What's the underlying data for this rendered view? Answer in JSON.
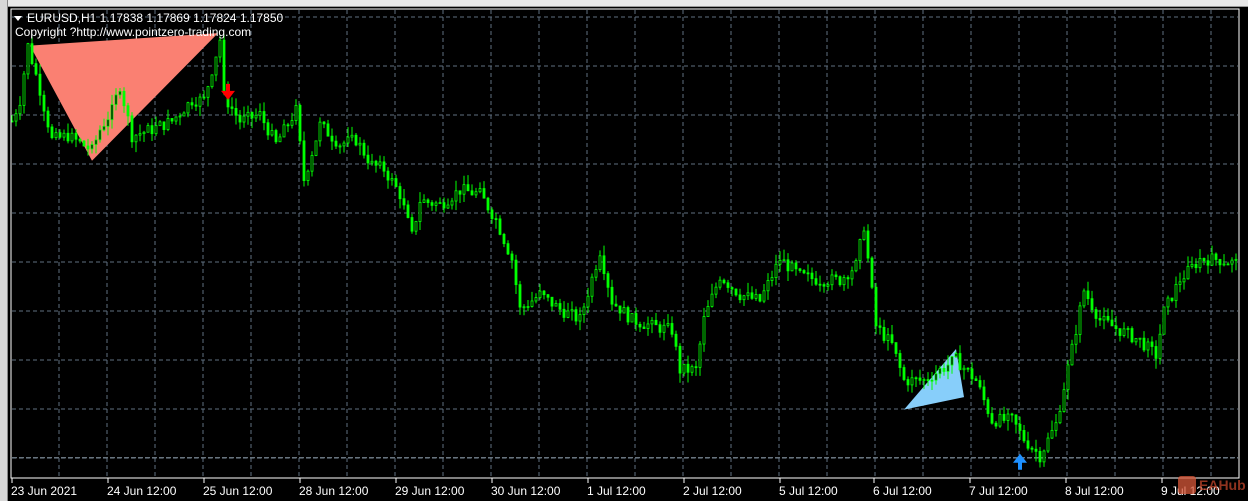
{
  "header": {
    "symbol_line": "EURUSD,H1  1.17838 1.17869 1.17824 1.17850",
    "copyright": "Copyright ?http://www.pointzero-trading.com"
  },
  "watermark": {
    "text": "EAHub"
  },
  "colors": {
    "candle": "#00ff00",
    "grid": "#5f6f80",
    "sell_triangle": "#fa8072",
    "buy_triangle": "#87cefa",
    "sell_arrow": "#ff0000",
    "buy_arrow": "#1e90ff"
  },
  "chart_data": {
    "type": "candlestick",
    "symbol": "EURUSD",
    "timeframe": "H1",
    "ohlc_last": {
      "open": 1.17838,
      "high": 1.17869,
      "low": 1.17824,
      "close": 1.1785
    },
    "x_tick_labels": [
      "23 Jun 2021",
      "24 Jun 12:00",
      "25 Jun 12:00",
      "28 Jun 12:00",
      "29 Jun 12:00",
      "30 Jun 12:00",
      "1 Jul 12:00",
      "2 Jul 12:00",
      "5 Jul 12:00",
      "6 Jul 12:00",
      "7 Jul 12:00",
      "8 Jul 12:00",
      "9 Jul 12:00"
    ],
    "price_range": [
      1.177,
      1.2
    ],
    "close_path_hour_price": [
      [
        0,
        1.1946
      ],
      [
        2,
        1.1956
      ],
      [
        4,
        1.1982
      ],
      [
        7,
        1.1961
      ],
      [
        10,
        1.1937
      ],
      [
        14,
        1.1939
      ],
      [
        20,
        1.1932
      ],
      [
        22,
        1.1942
      ],
      [
        25,
        1.1951
      ],
      [
        27,
        1.1963
      ],
      [
        30,
        1.1939
      ],
      [
        35,
        1.1942
      ],
      [
        40,
        1.1946
      ],
      [
        45,
        1.1956
      ],
      [
        48,
        1.1956
      ],
      [
        52,
        1.1985
      ],
      [
        53,
        1.1958
      ],
      [
        57,
        1.1946
      ],
      [
        62,
        1.1949
      ],
      [
        66,
        1.1935
      ],
      [
        71,
        1.1951
      ],
      [
        73,
        1.1918
      ],
      [
        77,
        1.1944
      ],
      [
        82,
        1.1935
      ],
      [
        86,
        1.1937
      ],
      [
        90,
        1.1925
      ],
      [
        93,
        1.1923
      ],
      [
        97,
        1.1911
      ],
      [
        100,
        1.1891
      ],
      [
        102,
        1.1908
      ],
      [
        107,
        1.1906
      ],
      [
        112,
        1.1913
      ],
      [
        117,
        1.1911
      ],
      [
        121,
        1.1899
      ],
      [
        125,
        1.188
      ],
      [
        127,
        1.1856
      ],
      [
        132,
        1.1863
      ],
      [
        137,
        1.1856
      ],
      [
        142,
        1.1851
      ],
      [
        147,
        1.1884
      ],
      [
        150,
        1.186
      ],
      [
        155,
        1.1851
      ],
      [
        160,
        1.1848
      ],
      [
        165,
        1.1846
      ],
      [
        167,
        1.1827
      ],
      [
        171,
        1.1827
      ],
      [
        173,
        1.1851
      ],
      [
        177,
        1.1872
      ],
      [
        182,
        1.1863
      ],
      [
        187,
        1.186
      ],
      [
        192,
        1.188
      ],
      [
        197,
        1.1872
      ],
      [
        202,
        1.187
      ],
      [
        207,
        1.187
      ],
      [
        211,
        1.1877
      ],
      [
        213,
        1.1896
      ],
      [
        216,
        1.1848
      ],
      [
        220,
        1.1839
      ],
      [
        223,
        1.1822
      ],
      [
        228,
        1.1822
      ],
      [
        236,
        1.1832
      ],
      [
        241,
        1.1822
      ],
      [
        245,
        1.1803
      ],
      [
        250,
        1.1803
      ],
      [
        253,
        1.1794
      ],
      [
        257,
        1.1786
      ],
      [
        261,
        1.1801
      ],
      [
        265,
        1.1837
      ],
      [
        268,
        1.1865
      ],
      [
        272,
        1.1851
      ],
      [
        277,
        1.1846
      ],
      [
        282,
        1.1841
      ],
      [
        286,
        1.1834
      ],
      [
        288,
        1.1855
      ],
      [
        292,
        1.187
      ],
      [
        297,
        1.188
      ],
      [
        301,
        1.188
      ],
      [
        306,
        1.1878
      ]
    ],
    "patterns": [
      {
        "kind": "sell",
        "triangle": [
          [
            4.5,
            1.1982
          ],
          [
            51.5,
            1.1988
          ],
          [
            20,
            1.1927
          ]
        ],
        "arrow": [
          54,
          1.1958
        ]
      },
      {
        "kind": "buy",
        "triangle": [
          [
            223,
            1.1808
          ],
          [
            236,
            1.1837
          ],
          [
            238,
            1.1814
          ]
        ],
        "arrow": [
          252,
          1.1785
        ]
      }
    ],
    "current_price": 1.1785
  }
}
